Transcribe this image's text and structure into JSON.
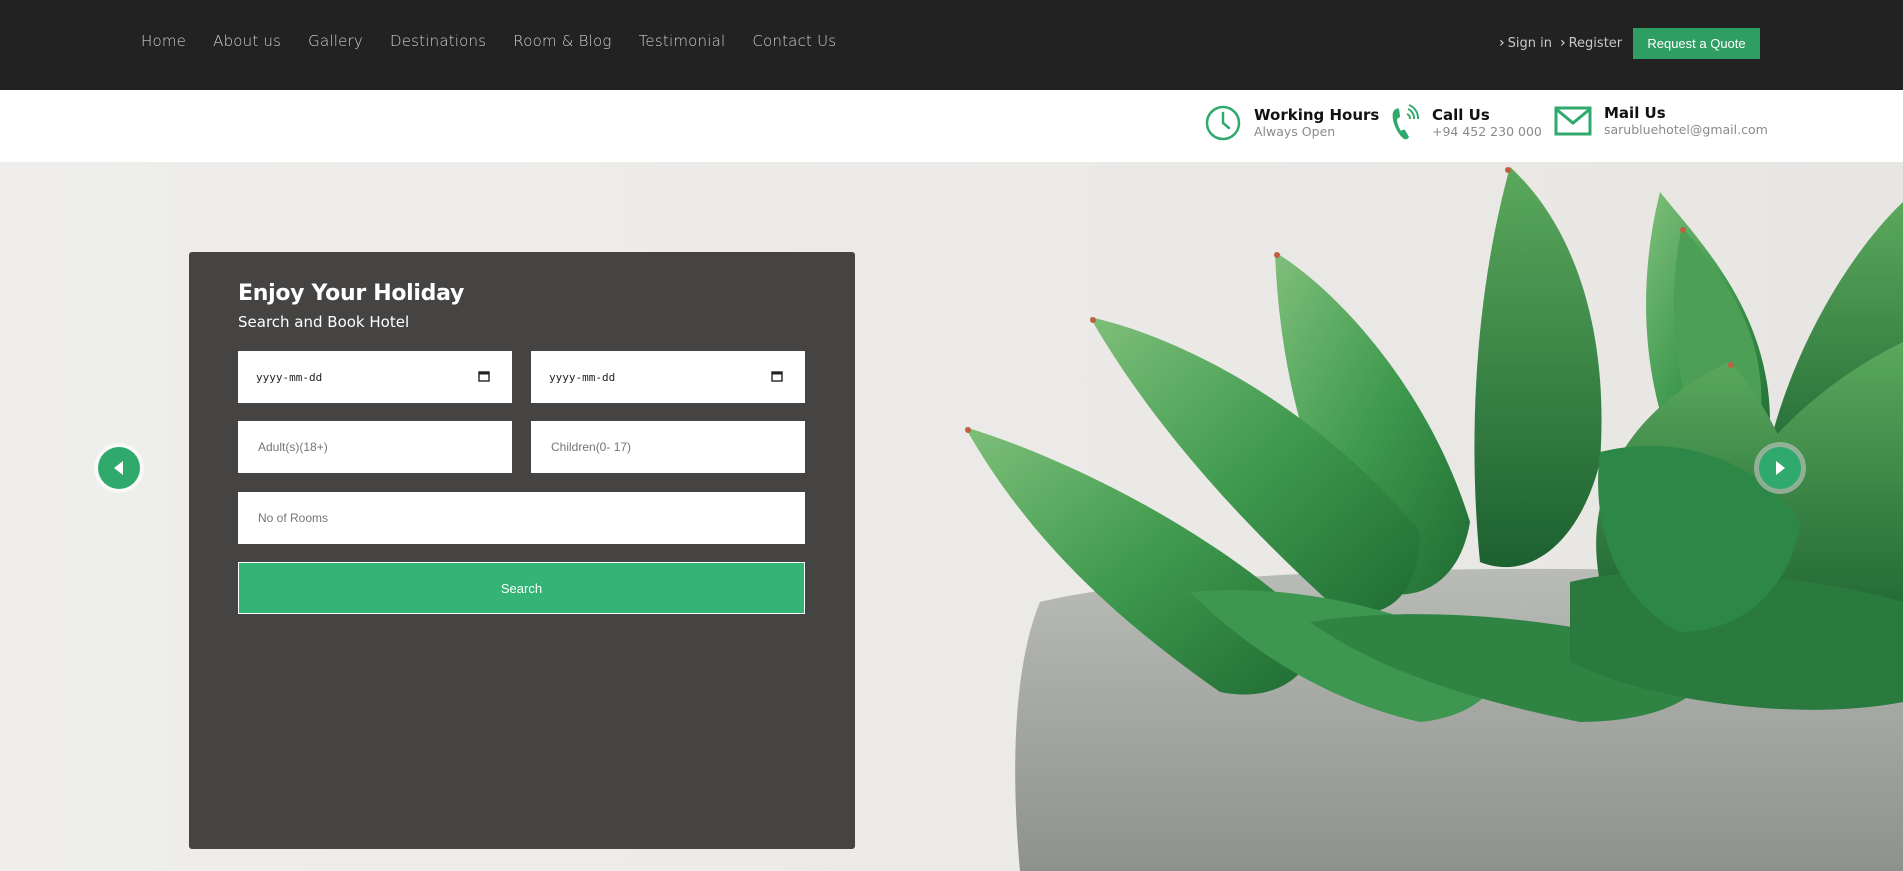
{
  "nav": {
    "items": [
      "Home",
      "About us",
      "Gallery",
      "Destinations",
      "Room & Blog",
      "Testimonial",
      "Contact Us"
    ],
    "sign_in": "Sign in",
    "register": "Register",
    "quote_button": "Request a Quote"
  },
  "info": {
    "hours_title": "Working Hours",
    "hours_value": "Always Open",
    "call_title": "Call Us",
    "call_value": "+94 452 230 000",
    "mail_title": "Mail Us",
    "mail_value": "sarubluehotel@gmail.com"
  },
  "booking": {
    "title": "Enjoy Your Holiday",
    "subtitle": "Search and Book Hotel",
    "checkin_value": "yyyy-mm-dd",
    "checkout_value": "yyyy-mm-dd",
    "adults_placeholder": "Adult(s)(18+)",
    "children_placeholder": "Children(0- 17)",
    "rooms_placeholder": "No of Rooms",
    "search_label": "Search"
  },
  "colors": {
    "accent": "#33b474",
    "topbar": "#222222",
    "panel": "#454443"
  },
  "icons": [
    "clock-icon",
    "phone-icon",
    "mail-icon",
    "calendar-icon",
    "chevron-left-icon",
    "chevron-right-icon"
  ]
}
